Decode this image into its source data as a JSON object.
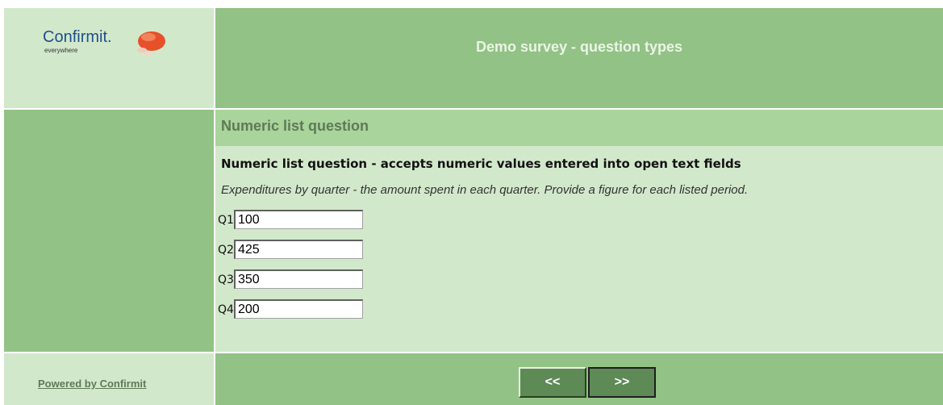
{
  "logo": {
    "brand": "Confirmit.",
    "tagline": "everywhere"
  },
  "header": {
    "title": "Demo survey - question types"
  },
  "question": {
    "section_title": "Numeric list question",
    "text": "Numeric list question - accepts numeric values entered into open text fields",
    "instruction": "Expenditures by quarter - the amount spent in each quarter. Provide a figure for each listed period.",
    "rows": [
      {
        "label": "Q1",
        "value": "100"
      },
      {
        "label": "Q2",
        "value": "425"
      },
      {
        "label": "Q3",
        "value": "350"
      },
      {
        "label": "Q4",
        "value": "200"
      }
    ]
  },
  "footer": {
    "powered_by": "Powered by Confirmit",
    "back_label": "<<",
    "next_label": ">>"
  },
  "colors": {
    "dark_green": "#92c285",
    "light_green": "#d2e8cb",
    "title_bar": "#a9d49c",
    "button": "#5e8a55",
    "logo_bubble": "#e8502a"
  }
}
